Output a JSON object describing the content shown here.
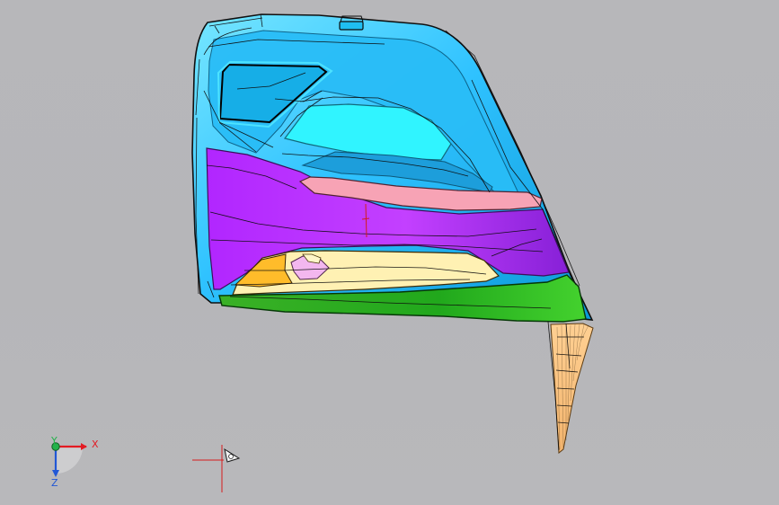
{
  "viewport": {
    "background": "#b7b7ba"
  },
  "model": {
    "colors": {
      "outline": "#101010",
      "shell": "#2fc2ff",
      "shell_dark": "#0c93cf",
      "shell_light": "#7fe6ff",
      "purple": "#b12cff",
      "purple_dark": "#7f18c7",
      "pink": "#f7a3b5",
      "cream": "#fff3b8",
      "orange": "#ffbd2e",
      "green": "#21b317",
      "green_dark": "#097b0f",
      "cyan": "#27f4ff",
      "tan": "#ffc77f"
    }
  },
  "triad": {
    "x_label": "X",
    "y_label": "Y",
    "z_label": "Z",
    "colors": {
      "x": "#e31b23",
      "y": "#23b24a",
      "z": "#2157d6"
    }
  },
  "marker": {
    "color": "#d61d1d"
  }
}
